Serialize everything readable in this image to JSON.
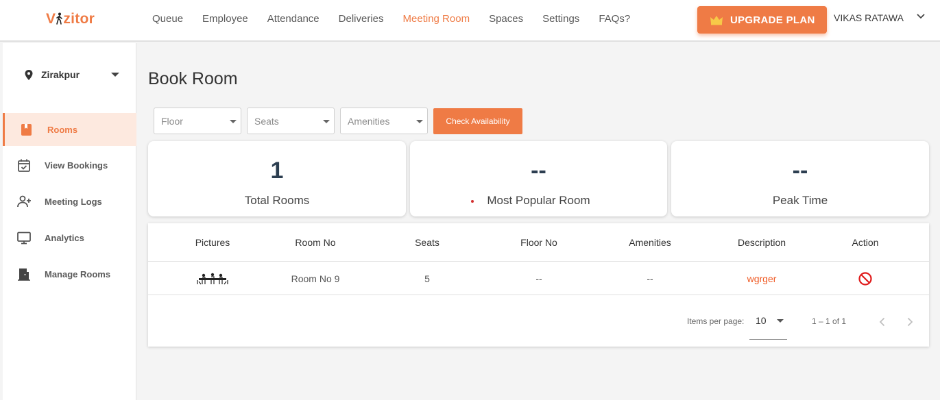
{
  "app": {
    "logo_text_a": "V",
    "logo_text_b": "zitor",
    "brand_color": "#ef7b45"
  },
  "nav": {
    "items": [
      {
        "label": "Queue"
      },
      {
        "label": "Employee"
      },
      {
        "label": "Attendance"
      },
      {
        "label": "Deliveries"
      },
      {
        "label": "Meeting Room",
        "active": true
      },
      {
        "label": "Spaces"
      },
      {
        "label": "Settings"
      },
      {
        "label": "FAQs?"
      }
    ],
    "upgrade_label": "UPGRADE PLAN",
    "user_name": "VIKAS RATAWA"
  },
  "sidebar": {
    "location": "Zirakpur",
    "items": [
      {
        "label": "Rooms",
        "icon": "book-icon",
        "active": true
      },
      {
        "label": "View Bookings",
        "icon": "calendar-check-icon"
      },
      {
        "label": "Meeting Logs",
        "icon": "person-add-icon"
      },
      {
        "label": "Analytics",
        "icon": "monitor-icon"
      },
      {
        "label": "Manage Rooms",
        "icon": "door-icon"
      }
    ]
  },
  "main": {
    "title": "Book Room",
    "filters": {
      "floor_placeholder": "Floor",
      "seats_placeholder": "Seats",
      "amenities_placeholder": "Amenities",
      "check_label": "Check Availability"
    },
    "stats": [
      {
        "value": "1",
        "label": "Total Rooms"
      },
      {
        "value": "--",
        "label": "Most Popular Room"
      },
      {
        "value": "--",
        "label": "Peak Time"
      }
    ],
    "table": {
      "headers": [
        "Pictures",
        "Room No",
        "Seats",
        "Floor No",
        "Amenities",
        "Description",
        "Action"
      ],
      "rows": [
        {
          "room_no": "Room No 9",
          "seats": "5",
          "floor_no": "--",
          "amenities": "--",
          "description": "wgrger",
          "action_icon": "block-icon"
        }
      ]
    },
    "paginator": {
      "items_per_page_label": "Items per page:",
      "items_per_page": "10",
      "range": "1 – 1 of 1"
    }
  }
}
